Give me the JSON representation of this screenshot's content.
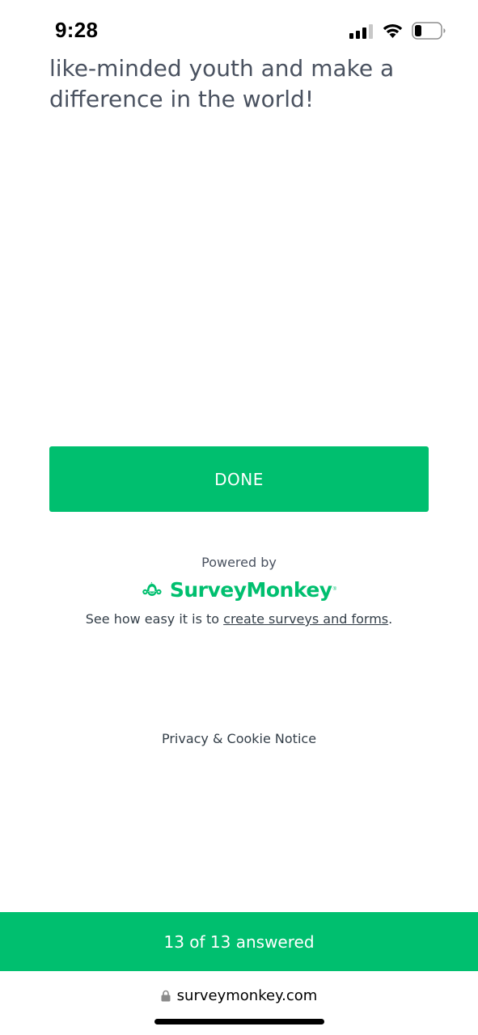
{
  "status_bar": {
    "time": "9:28",
    "icons": [
      "signal-icon",
      "wifi-icon",
      "battery-icon"
    ]
  },
  "content": {
    "intro_text": "like-minded youth and make a difference in the world!",
    "done_label": "DONE"
  },
  "footer": {
    "powered_by": "Powered by",
    "brand_name": "SurveyMonkey",
    "brand_mark": "®",
    "promo_prefix": "See how easy it is to ",
    "promo_link": "create surveys and forms",
    "promo_suffix": ".",
    "privacy_link": "Privacy & Cookie Notice"
  },
  "progress": {
    "label": "13 of 13 answered",
    "answered": 13,
    "total": 13
  },
  "browser": {
    "url": "surveymonkey.com",
    "lock_icon": "lock-icon"
  },
  "colors": {
    "accent": "#00bf6f",
    "text": "#4a5260",
    "dark_text": "#333e48"
  }
}
